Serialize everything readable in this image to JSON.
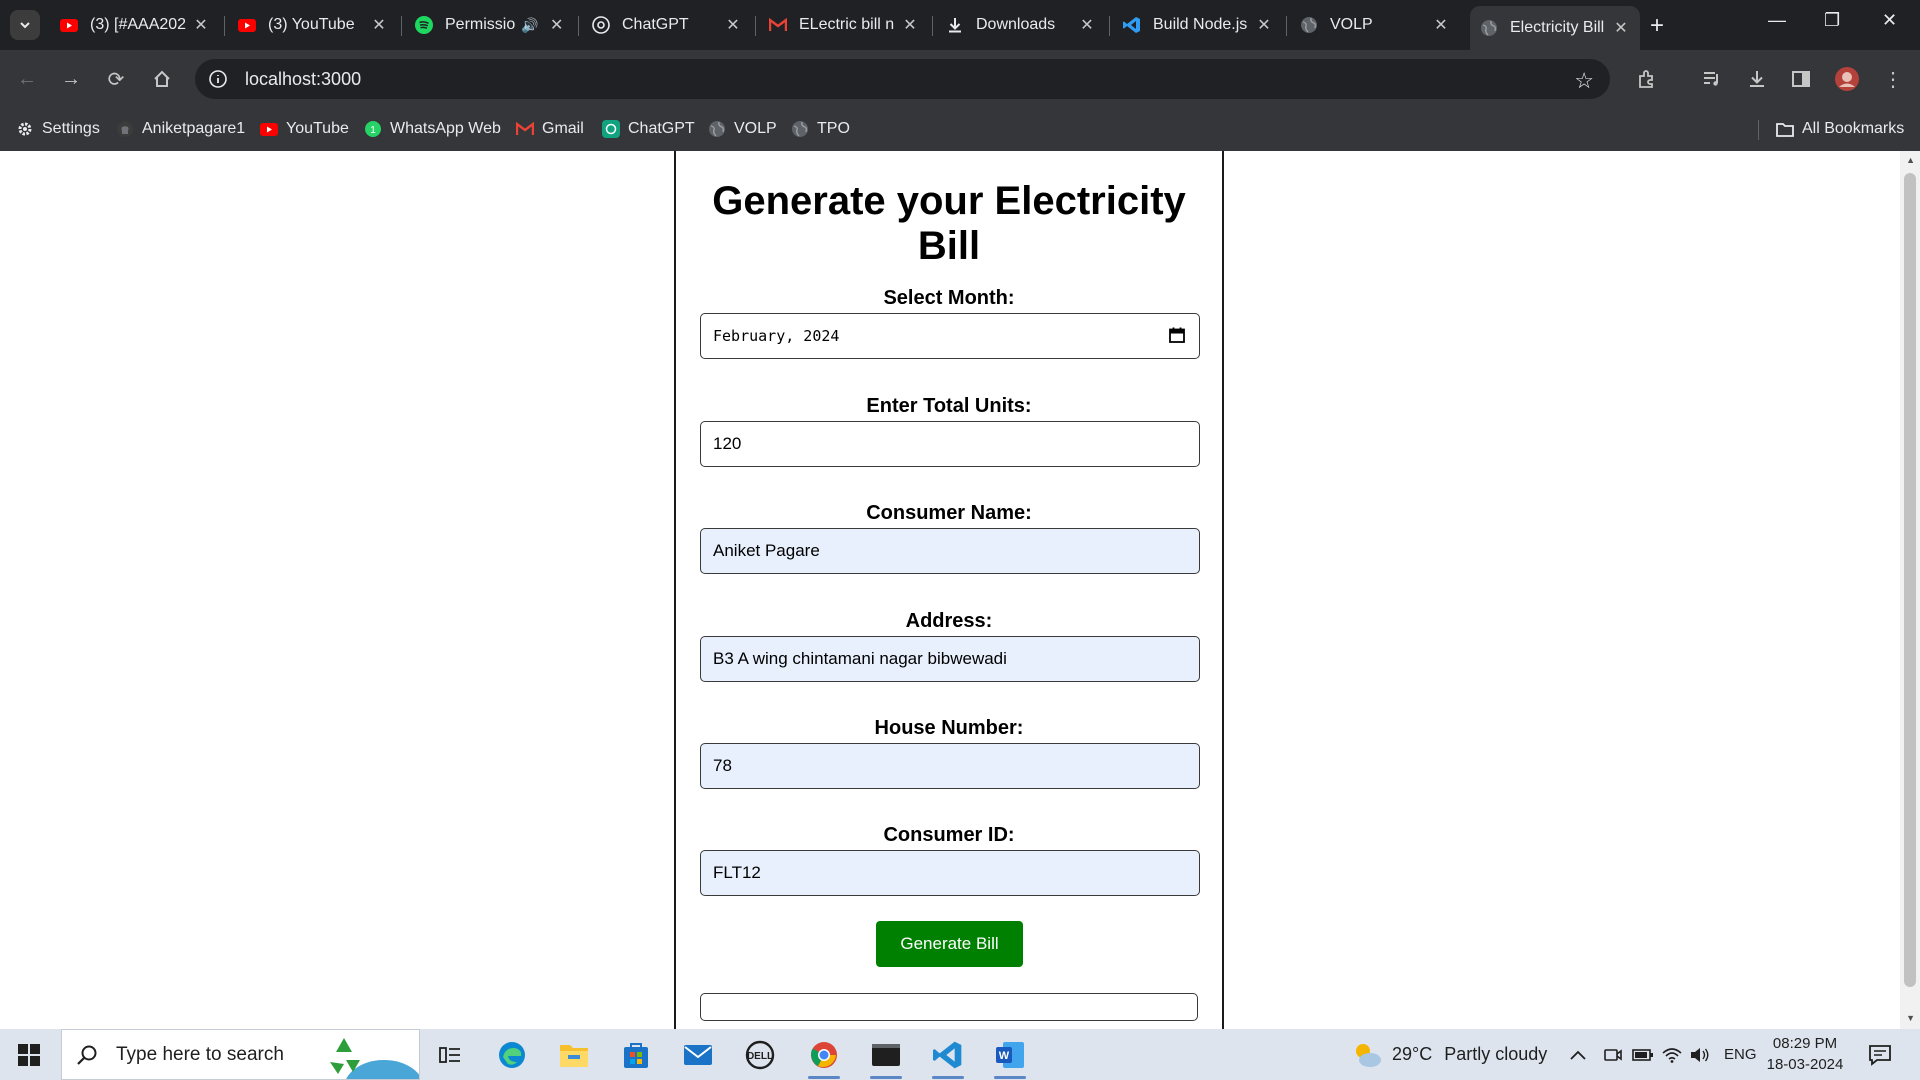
{
  "browser": {
    "tabs": [
      {
        "title": "(3) [#AAA202",
        "icon": "youtube-icon"
      },
      {
        "title": "(3) YouTube",
        "icon": "youtube-icon"
      },
      {
        "title": "Permissio",
        "icon": "spotify-icon",
        "audio": "🔊"
      },
      {
        "title": "ChatGPT",
        "icon": "chatgpt-icon"
      },
      {
        "title": "ELectric bill n",
        "icon": "gmail-icon"
      },
      {
        "title": "Downloads",
        "icon": "download-icon"
      },
      {
        "title": "Build Node.js",
        "icon": "vscode-icon"
      },
      {
        "title": "VOLP",
        "icon": "globe-icon"
      },
      {
        "title": "Electricity Bill",
        "icon": "globe-icon",
        "active": true
      }
    ],
    "url": "localhost:3000",
    "bookmarks": [
      {
        "label": "Settings",
        "icon": "gear-icon"
      },
      {
        "label": "Aniketpagare1",
        "icon": "github-icon"
      },
      {
        "label": "YouTube",
        "icon": "youtube-icon"
      },
      {
        "label": "WhatsApp Web",
        "icon": "whatsapp-icon"
      },
      {
        "label": "Gmail",
        "icon": "gmail-icon"
      },
      {
        "label": "ChatGPT",
        "icon": "chatgpt-icon"
      },
      {
        "label": "VOLP",
        "icon": "globe-icon"
      },
      {
        "label": "TPO",
        "icon": "globe-icon"
      }
    ],
    "all_bookmarks": "All Bookmarks"
  },
  "form": {
    "title": "Generate your Electricity Bill",
    "month_label": "Select Month:",
    "month_value": "February, 2024",
    "units_label": "Enter Total Units:",
    "units_value": "120",
    "name_label": "Consumer Name:",
    "name_value": "Aniket Pagare",
    "address_label": "Address:",
    "address_value": "B3 A wing chintamani nagar bibwewadi",
    "house_label": "House Number:",
    "house_value": "78",
    "consumer_id_label": "Consumer ID:",
    "consumer_id_value": "FLT12",
    "generate_button": "Generate Bill"
  },
  "taskbar": {
    "search_placeholder": "Type here to search",
    "weather_temp": "29°C",
    "weather_desc": "Partly cloudy",
    "language": "ENG",
    "time": "08:29 PM",
    "date": "18-03-2024"
  },
  "colors": {
    "button_green": "#008000",
    "autofill_bg": "#e8f0fe",
    "chrome_dark": "#202124",
    "taskbar_bg": "#dde4ed"
  }
}
